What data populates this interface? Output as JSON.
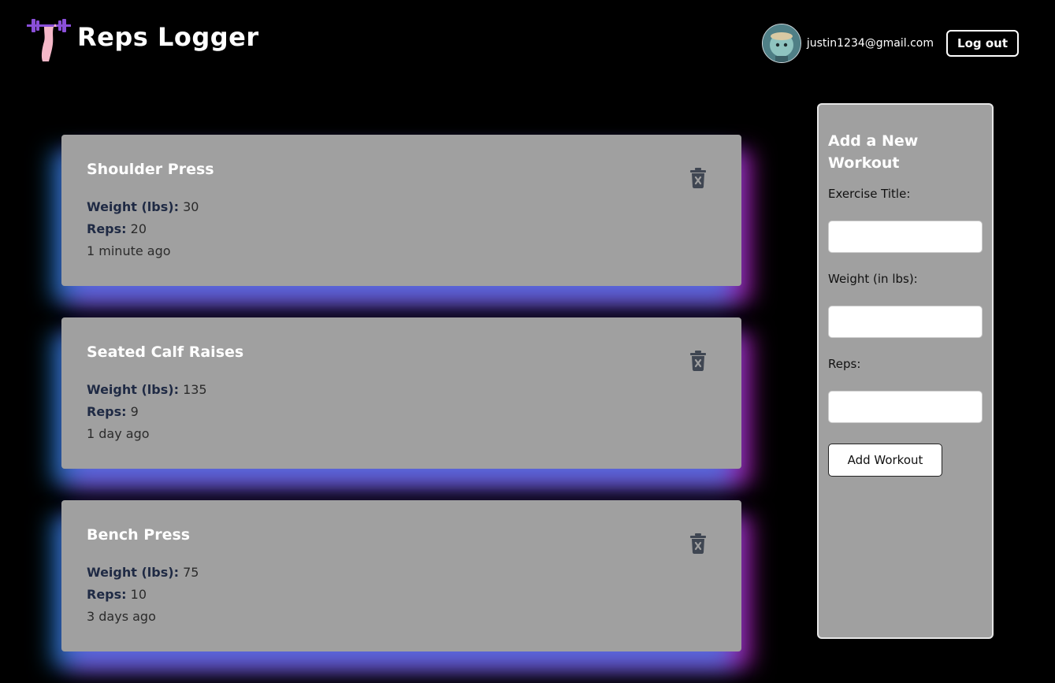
{
  "header": {
    "brand_title": "Reps Logger",
    "user_email": "justin1234@gmail.com",
    "logout_label": "Log out"
  },
  "workouts": [
    {
      "title": "Shoulder Press",
      "weight_label": "Weight (lbs):",
      "weight": "30",
      "reps_label": "Reps:",
      "reps": "20",
      "time": "1 minute ago"
    },
    {
      "title": "Seated Calf Raises",
      "weight_label": "Weight (lbs):",
      "weight": "135",
      "reps_label": "Reps:",
      "reps": "9",
      "time": "1 day ago"
    },
    {
      "title": "Bench Press",
      "weight_label": "Weight (lbs):",
      "weight": "75",
      "reps_label": "Reps:",
      "reps": "10",
      "time": "3 days ago"
    }
  ],
  "form": {
    "title": "Add a New Workout",
    "title_label": "Exercise Title:",
    "title_value": "",
    "weight_label": "Weight (in lbs):",
    "weight_value": "",
    "reps_label": "Reps:",
    "reps_value": "",
    "submit_label": "Add Workout"
  },
  "colors": {
    "background": "#000000",
    "card": "#a0a0a0",
    "glow_left": "#24a0ff",
    "glow_right": "#dc28e6",
    "logo_accent": "#8a4fd8",
    "logo_figure": "#f5b8c8"
  },
  "icons": {
    "brand": "dumbbell-lifter-icon",
    "delete": "trash-icon",
    "avatar": "avatar-image"
  }
}
